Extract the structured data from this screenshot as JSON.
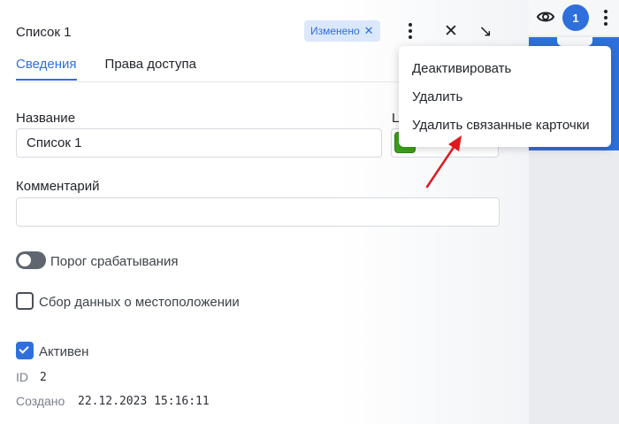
{
  "header": {
    "title": "Список 1",
    "badge_label": "Изменено",
    "badge_close_glyph": "✕",
    "close_glyph": "✕",
    "collapse_glyph": "↘"
  },
  "tabs": [
    {
      "label": "Сведения",
      "active": true
    },
    {
      "label": "Права доступа",
      "active": false
    }
  ],
  "form": {
    "name_label": "Название",
    "name_value": "Список 1",
    "color_label_partial": "Ц",
    "color_value": "#3aa318",
    "comment_label": "Комментарий",
    "comment_value": ""
  },
  "options": {
    "threshold": {
      "label": "Порог срабатывания",
      "on": false
    },
    "location": {
      "label": "Сбор данных о местоположении",
      "checked": false
    },
    "active": {
      "label": "Активен",
      "checked": true
    }
  },
  "meta": {
    "id_label": "ID",
    "id_value": "2",
    "created_label": "Создано",
    "created_value": "22.12.2023 15:16:11"
  },
  "menu": {
    "items": [
      "Деактивировать",
      "Удалить",
      "Удалить связанные карточки"
    ]
  },
  "topbar": {
    "avatar_count": "1"
  },
  "colors": {
    "accent": "#2f6fdc",
    "annotation_arrow": "#e0191f"
  }
}
